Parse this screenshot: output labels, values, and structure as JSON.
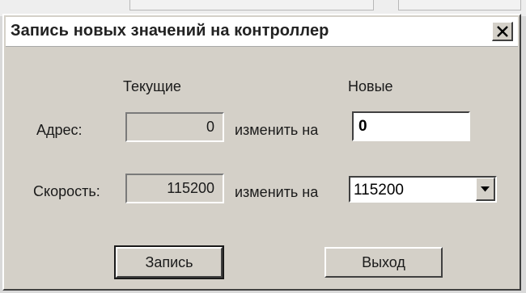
{
  "window": {
    "title": "Запись новых значений на контроллер",
    "close_glyph": "✕"
  },
  "columns": {
    "current": "Текущие",
    "new": "Новые"
  },
  "rows": {
    "address": {
      "label": "Адрес:",
      "current_value": "0",
      "change_label": "изменить на",
      "new_value": "0"
    },
    "speed": {
      "label": "Скорость:",
      "current_value": "115200",
      "change_label": "изменить на",
      "selected_option": "115200"
    }
  },
  "buttons": {
    "write": "Запись",
    "exit": "Выход"
  },
  "colors": {
    "dialog_face": "#d4d0c8",
    "title_bg": "#ffffff",
    "field_bg": "#ffffff"
  },
  "icons": {
    "close": "close-icon",
    "dropdown": "chevron-down-icon"
  }
}
